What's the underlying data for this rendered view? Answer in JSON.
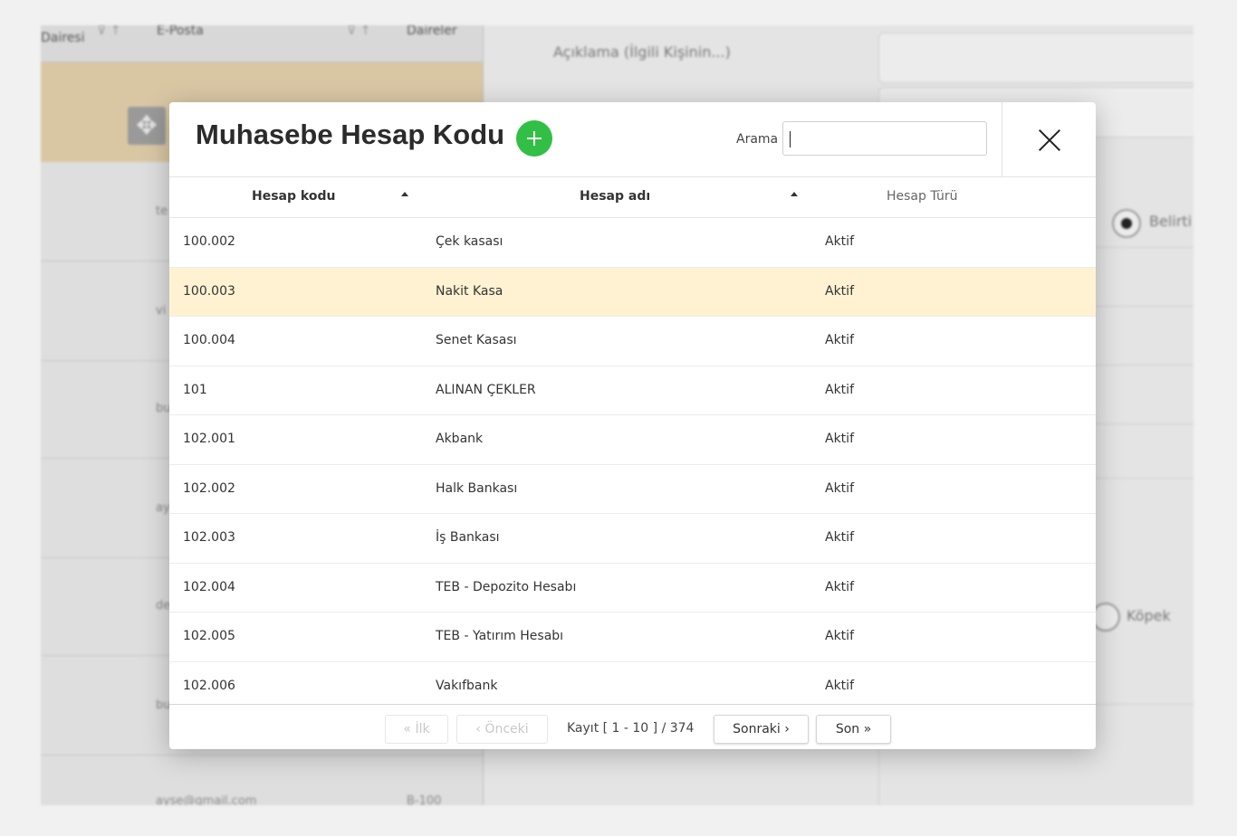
{
  "background": {
    "left_table_headers": [
      "Dairesi",
      "E-Posta",
      "Daireler"
    ],
    "left_row_snippets": [
      "te",
      "vi",
      "bu",
      "ay",
      "de",
      "bu"
    ],
    "bottom_email": "ayse@gmail.com",
    "bottom_code": "B-100",
    "description_label": "Açıklama (İlgili Kişinin...)",
    "radio_selected_label": "Belirti",
    "radio_dog_label": "Köpek"
  },
  "modal": {
    "title": "Muhasebe Hesap Kodu",
    "search_label": "Arama",
    "search_value": "",
    "columns": [
      "Hesap kodu",
      "Hesap adı",
      "Hesap Türü"
    ],
    "rows": [
      {
        "code": "100.002",
        "name": "Çek kasası",
        "type": "Aktif"
      },
      {
        "code": "100.003",
        "name": "Nakit Kasa",
        "type": "Aktif"
      },
      {
        "code": "100.004",
        "name": "Senet Kasası",
        "type": "Aktif"
      },
      {
        "code": "101",
        "name": "ALINAN ÇEKLER",
        "type": "Aktif"
      },
      {
        "code": "102.001",
        "name": "Akbank",
        "type": "Aktif"
      },
      {
        "code": "102.002",
        "name": "Halk Bankası",
        "type": "Aktif"
      },
      {
        "code": "102.003",
        "name": "İş Bankası",
        "type": "Aktif"
      },
      {
        "code": "102.004",
        "name": "TEB - Depozito Hesabı",
        "type": "Aktif"
      },
      {
        "code": "102.005",
        "name": "TEB - Yatırım Hesabı",
        "type": "Aktif"
      },
      {
        "code": "102.006",
        "name": "Vakıfbank",
        "type": "Aktif"
      }
    ],
    "selected_row_index": 1,
    "pagination": {
      "first": "« İlk",
      "prev": "‹ Önceki",
      "info": "Kayıt [ 1 - 10 ] / 374",
      "next": "Sonraki ›",
      "last": "Son »"
    }
  },
  "colors": {
    "accent_add": "#31bf46",
    "selected_row": "#fef2d2",
    "bg_selection": "#d9c7a4"
  },
  "icons": {
    "add": "plus-circle-icon",
    "close": "close-icon",
    "move": "move-icon",
    "sort": "sort-asc-icon"
  }
}
